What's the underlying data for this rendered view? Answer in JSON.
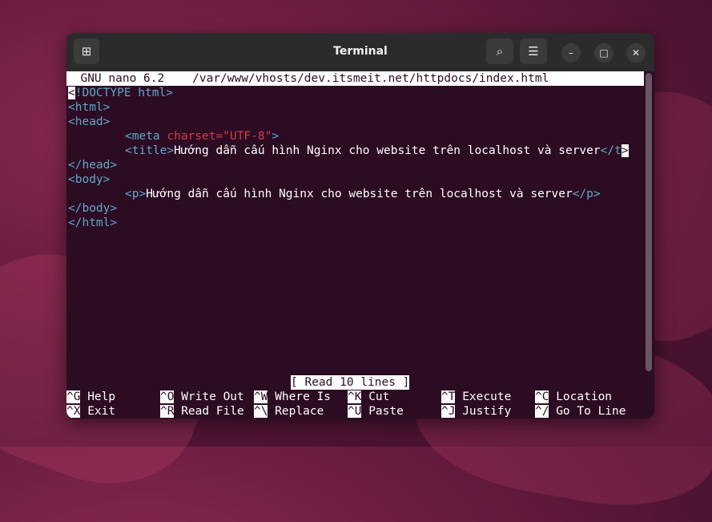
{
  "window": {
    "title": "Terminal",
    "new_tab_icon": "⊞",
    "search_icon": "⌕",
    "menu_icon": "☰",
    "minimize_icon": "–",
    "maximize_icon": "□",
    "close_icon": "✕"
  },
  "nano": {
    "header": "  GNU nano 6.2    /var/www/vhosts/dev.itsmeit.net/httpdocs/index.html",
    "file": {
      "doctype_first_char": "<",
      "doctype_rest": "!DOCTYPE html>",
      "html_open": "<html>",
      "head_open": "<head>",
      "meta_tag_open": "<meta",
      "meta_attr": "charset",
      "meta_eq_value": "=\"UTF-8\"",
      "meta_close": ">",
      "title_open": "<title>",
      "title_text": "Hướng dẫn cấu hình Nginx cho website trên localhost và server",
      "title_close_partial": "</t",
      "overflow_marker": ">",
      "head_close": "</head>",
      "body_open": "<body>",
      "p_open": "<p>",
      "p_text": "Hướng dẫn cấu hình Nginx cho website trên localhost và server",
      "p_close": "</p>",
      "body_close": "</body>",
      "html_close": "</html>"
    },
    "status": "[ Read 10 lines ]",
    "shortcuts": [
      {
        "key": "^G",
        "label": "Help"
      },
      {
        "key": "^O",
        "label": "Write Out"
      },
      {
        "key": "^W",
        "label": "Where Is"
      },
      {
        "key": "^K",
        "label": "Cut"
      },
      {
        "key": "^T",
        "label": "Execute"
      },
      {
        "key": "^C",
        "label": "Location"
      },
      {
        "key": "^X",
        "label": "Exit"
      },
      {
        "key": "^R",
        "label": "Read File"
      },
      {
        "key": "^\\",
        "label": "Replace"
      },
      {
        "key": "^U",
        "label": "Paste"
      },
      {
        "key": "^J",
        "label": "Justify"
      },
      {
        "key": "^/",
        "label": "Go To Line"
      }
    ]
  }
}
